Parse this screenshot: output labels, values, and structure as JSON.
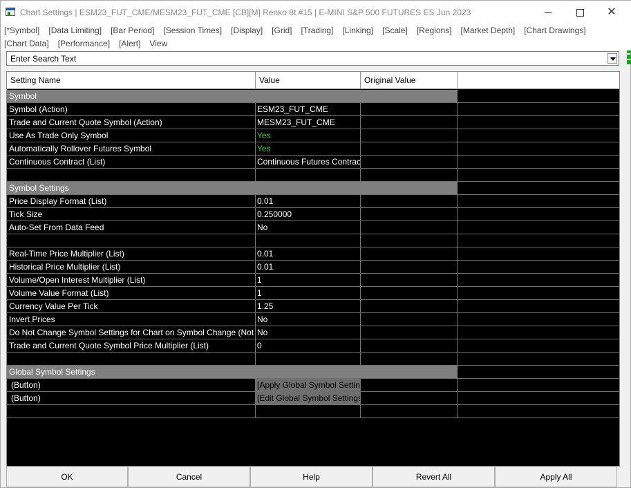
{
  "window": {
    "title": "Chart Settings | ESM23_FUT_CME/MESM23_FUT_CME [CB][M]  Renko 8t  #15 | E-MINI S&P 500 FUTURES ES Jun 2023",
    "minimize_glyph": "",
    "maximize_glyph": "",
    "close_glyph": "✕",
    "icon": "chart-settings-app-icon"
  },
  "menu": {
    "row1": [
      "[*Symbol]",
      "[Data Limiting]",
      "[Bar Period]",
      "[Session Times]",
      "[Display]",
      "[Grid]",
      "[Trading]",
      "[Linking]",
      "[Scale]",
      "[Regions]",
      "[Market Depth]",
      "[Chart Drawings]"
    ],
    "row2": [
      "[Chart Data]",
      "[Performance]",
      "[Alert]",
      "View"
    ]
  },
  "search": {
    "value": "Enter Search Text",
    "dropdown_icon": "chevron-down-icon"
  },
  "table": {
    "headers": [
      "Setting Name",
      "Value",
      "Original Value"
    ],
    "rows": [
      {
        "kind": "section",
        "name": "Symbol"
      },
      {
        "kind": "row",
        "name": "Symbol (Action)",
        "value": "ESM23_FUT_CME"
      },
      {
        "kind": "row",
        "name": "Trade and Current Quote Symbol (Action)",
        "value": "MESM23_FUT_CME"
      },
      {
        "kind": "row",
        "name": "Use As Trade Only Symbol",
        "value": "Yes",
        "value_color": "#2fd12f"
      },
      {
        "kind": "row",
        "name": "Automatically Rollover Futures Symbol",
        "value": "Yes",
        "value_color": "#2fd12f"
      },
      {
        "kind": "row",
        "name": "Continuous Contract (List)",
        "value": "Continuous Futures Contract"
      },
      {
        "kind": "blank"
      },
      {
        "kind": "section",
        "name": "Symbol Settings"
      },
      {
        "kind": "row",
        "name": "Price Display Format (List)",
        "value": "0.01"
      },
      {
        "kind": "row",
        "name": "Tick Size",
        "value": "0.250000"
      },
      {
        "kind": "row",
        "name": "Auto-Set From Data Feed",
        "value": "No"
      },
      {
        "kind": "blank"
      },
      {
        "kind": "row",
        "name": "Real-Time Price Multiplier (List)",
        "value": "0.01"
      },
      {
        "kind": "row",
        "name": "Historical Price Multiplier (List)",
        "value": "0.01"
      },
      {
        "kind": "row",
        "name": "Volume/Open Interest Multiplier (List)",
        "value": "1"
      },
      {
        "kind": "row",
        "name": "Volume Value Format (List)",
        "value": "1"
      },
      {
        "kind": "row",
        "name": "Currency Value Per Tick",
        "value": "1.25"
      },
      {
        "kind": "row",
        "name": "Invert Prices",
        "value": "No"
      },
      {
        "kind": "row",
        "name": "Do Not Change Symbol Settings for Chart on Symbol Change (Not Recommended)",
        "value": "No"
      },
      {
        "kind": "row",
        "name": "Trade and Current Quote Symbol Price Multiplier (List)",
        "value": "0"
      },
      {
        "kind": "blank"
      },
      {
        "kind": "section",
        "name": "Global Symbol Settings"
      },
      {
        "kind": "button",
        "name": "(Button)",
        "value": "[Apply Global Symbol Settings]"
      },
      {
        "kind": "button",
        "name": "(Button)",
        "value": "[Edit Global Symbol Settings]"
      },
      {
        "kind": "blank"
      }
    ]
  },
  "footer": {
    "buttons": [
      "OK",
      "Cancel",
      "Help",
      "Revert All",
      "Apply All"
    ]
  },
  "colors": {
    "grid_background": "#000000",
    "section_background": "#7f7f7f",
    "yes_color": "#2fd12f",
    "button_cell": "#6e6e6e"
  }
}
